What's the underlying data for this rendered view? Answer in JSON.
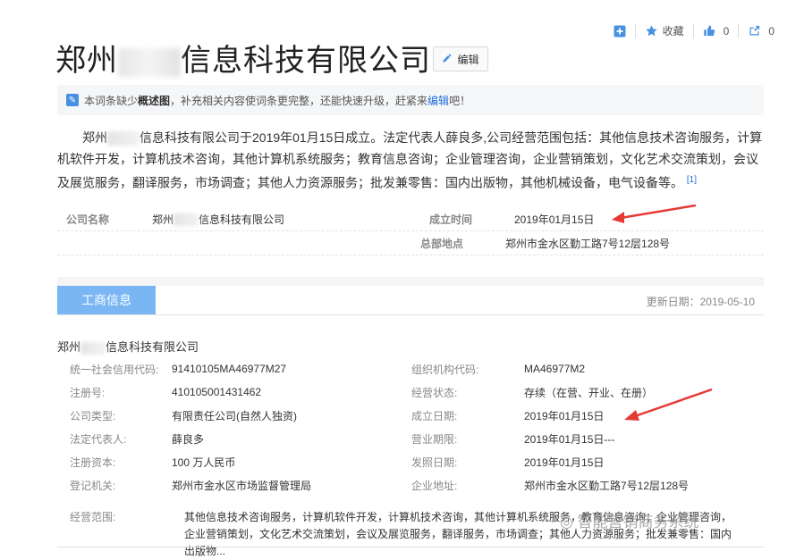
{
  "toolbar": {
    "add_label": "",
    "favorite_label": "收藏",
    "like_count": "0",
    "share_count": "0"
  },
  "header": {
    "title_prefix": "郑州",
    "title_suffix": "信息科技有限公司",
    "edit_label": "编辑"
  },
  "notice": {
    "text1": "本词条缺少",
    "bold": "概述图",
    "text2": "，补充相关内容使词条更完整，还能快速升级，赶紧来",
    "link": "编辑",
    "text3": "吧！"
  },
  "intro": {
    "prefix": "郑州",
    "text": "信息科技有限公司于2019年01月15日成立。法定代表人薛良多,公司经营范围包括：其他信息技术咨询服务，计算机软件开发，计算机技术咨询，其他计算机系统服务；教育信息咨询；企业管理咨询，企业营销策划，文化艺术交流策划，会议及展览服务，翻译服务，市场调查；其他人力资源服务；批发兼零售：国内出版物，其他机械设备，电气设备等。",
    "ref": "[1]"
  },
  "basic": {
    "company_label": "公司名称",
    "company_prefix": "郑州",
    "company_suffix": "信息科技有限公司",
    "founded_label": "成立时间",
    "founded_value": "2019年01月15日",
    "hq_label": "总部地点",
    "hq_value": "郑州市金水区勤工路7号12层128号"
  },
  "section": {
    "tab_label": "工商信息",
    "update_text": "更新日期：2019-05-10"
  },
  "company_name": {
    "prefix": "郑州",
    "suffix": "信息科技有限公司"
  },
  "info_rows": [
    {
      "l1": "统一社会信用代码:",
      "v1": "91410105MA46977M27",
      "l2": "组织机构代码:",
      "v2": "MA46977M2"
    },
    {
      "l1": "注册号:",
      "v1": "410105001431462",
      "l2": "经营状态:",
      "v2": "存续（在营、开业、在册）"
    },
    {
      "l1": "公司类型:",
      "v1": "有限责任公司(自然人独资)",
      "l2": "成立日期:",
      "v2": "2019年01月15日"
    },
    {
      "l1": "法定代表人:",
      "v1": "薛良多",
      "l2": "营业期限:",
      "v2": "2019年01月15日---"
    },
    {
      "l1": "注册资本:",
      "v1": "100 万人民币",
      "l2": "发照日期:",
      "v2": "2019年01月15日"
    },
    {
      "l1": "登记机关:",
      "v1": "郑州市金水区市场监督管理局",
      "l2": "企业地址:",
      "v2": "郑州市金水区勤工路7号12层128号"
    }
  ],
  "scope": {
    "label": "经营范围:",
    "text": "其他信息技术咨询服务，计算机软件开发，计算机技术咨询，其他计算机系统服务，教育信息咨询；企业管理咨询，企业营销策划，文化艺术交流策划，会议及展览服务，翻译服务，市场调查；其他人力资源服务；批发兼零售：国内出版物..."
  },
  "watermark": "智能营销商务系统",
  "colors": {
    "accent": "#79b6f3",
    "link": "#1e6fd9",
    "arrow": "#e53935"
  }
}
